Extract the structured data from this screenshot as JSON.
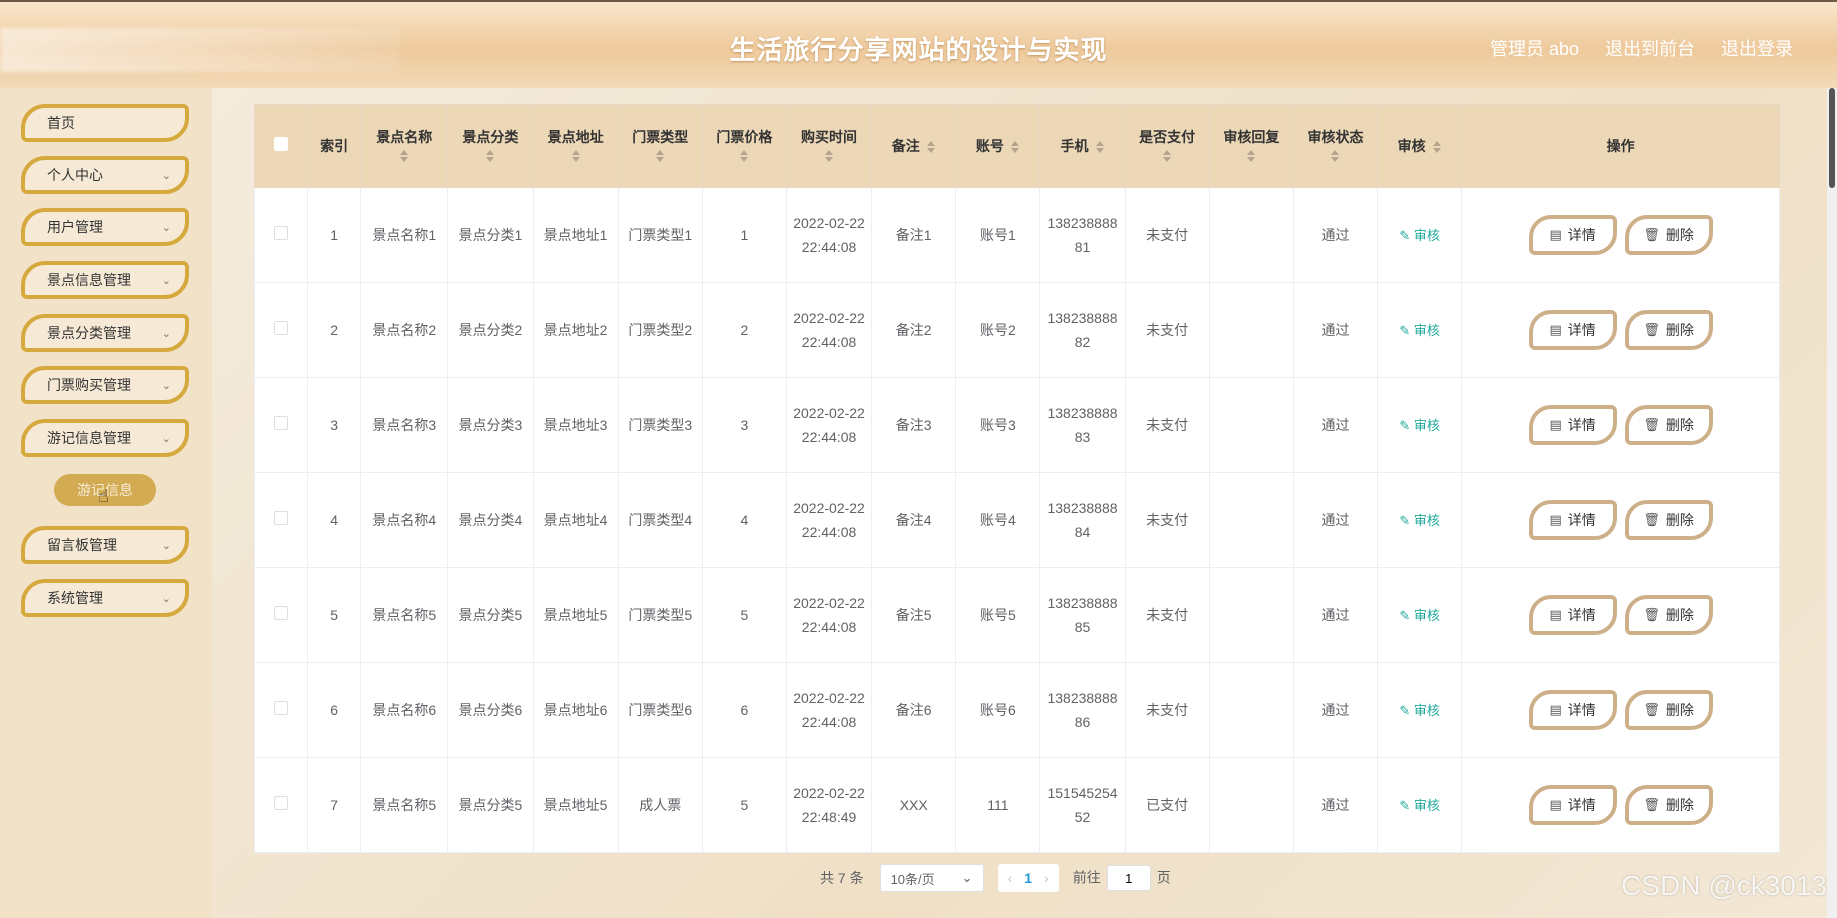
{
  "header": {
    "title": "生活旅行分享网站的设计与实现",
    "user": "管理员 abo",
    "to_front": "退出到前台",
    "logout": "退出登录"
  },
  "sidebar": {
    "items": [
      {
        "label": "首页",
        "expandable": false
      },
      {
        "label": "个人中心",
        "expandable": true
      },
      {
        "label": "用户管理",
        "expandable": true
      },
      {
        "label": "景点信息管理",
        "expandable": true
      },
      {
        "label": "景点分类管理",
        "expandable": true
      },
      {
        "label": "门票购买管理",
        "expandable": true
      },
      {
        "label": "游记信息管理",
        "expandable": true
      },
      {
        "label": "留言板管理",
        "expandable": true
      },
      {
        "label": "系统管理",
        "expandable": true
      }
    ],
    "sub_item": "游记信息"
  },
  "table": {
    "headers": [
      "索引",
      "景点名称",
      "景点分类",
      "景点地址",
      "门票类型",
      "门票价格",
      "购买时间",
      "备注",
      "账号",
      "手机",
      "是否支付",
      "审核回复",
      "审核状态",
      "审核",
      "操作"
    ],
    "audit_label": "审核",
    "detail_label": "详情",
    "delete_label": "删除",
    "rows": [
      {
        "idx": "1",
        "name": "景点名称1",
        "cat": "景点分类1",
        "addr": "景点地址1",
        "type": "门票类型1",
        "price": "1",
        "time": "2022-02-22 22:44:08",
        "note": "备注1",
        "acct": "账号1",
        "phone": "13823888881",
        "paid": "未支付",
        "reply": "",
        "status": "通过"
      },
      {
        "idx": "2",
        "name": "景点名称2",
        "cat": "景点分类2",
        "addr": "景点地址2",
        "type": "门票类型2",
        "price": "2",
        "time": "2022-02-22 22:44:08",
        "note": "备注2",
        "acct": "账号2",
        "phone": "13823888882",
        "paid": "未支付",
        "reply": "",
        "status": "通过"
      },
      {
        "idx": "3",
        "name": "景点名称3",
        "cat": "景点分类3",
        "addr": "景点地址3",
        "type": "门票类型3",
        "price": "3",
        "time": "2022-02-22 22:44:08",
        "note": "备注3",
        "acct": "账号3",
        "phone": "13823888883",
        "paid": "未支付",
        "reply": "",
        "status": "通过"
      },
      {
        "idx": "4",
        "name": "景点名称4",
        "cat": "景点分类4",
        "addr": "景点地址4",
        "type": "门票类型4",
        "price": "4",
        "time": "2022-02-22 22:44:08",
        "note": "备注4",
        "acct": "账号4",
        "phone": "13823888884",
        "paid": "未支付",
        "reply": "",
        "status": "通过"
      },
      {
        "idx": "5",
        "name": "景点名称5",
        "cat": "景点分类5",
        "addr": "景点地址5",
        "type": "门票类型5",
        "price": "5",
        "time": "2022-02-22 22:44:08",
        "note": "备注5",
        "acct": "账号5",
        "phone": "13823888885",
        "paid": "未支付",
        "reply": "",
        "status": "通过"
      },
      {
        "idx": "6",
        "name": "景点名称6",
        "cat": "景点分类6",
        "addr": "景点地址6",
        "type": "门票类型6",
        "price": "6",
        "time": "2022-02-22 22:44:08",
        "note": "备注6",
        "acct": "账号6",
        "phone": "13823888886",
        "paid": "未支付",
        "reply": "",
        "status": "通过"
      },
      {
        "idx": "7",
        "name": "景点名称5",
        "cat": "景点分类5",
        "addr": "景点地址5",
        "type": "成人票",
        "price": "5",
        "time": "2022-02-22 22:48:49",
        "note": "XXX",
        "acct": "111",
        "phone": "15154525452",
        "paid": "已支付",
        "reply": "",
        "status": "通过"
      }
    ]
  },
  "pagination": {
    "total": "共 7 条",
    "page_size": "10条/页",
    "current_page": "1",
    "goto_label": "前往",
    "goto_value": "1",
    "page_suffix": "页"
  },
  "watermark": "CSDN @ck3013",
  "colors": {
    "accent": "#d6a93f",
    "header_bg": "#ecd7b7",
    "audit": "#1ea89a"
  }
}
